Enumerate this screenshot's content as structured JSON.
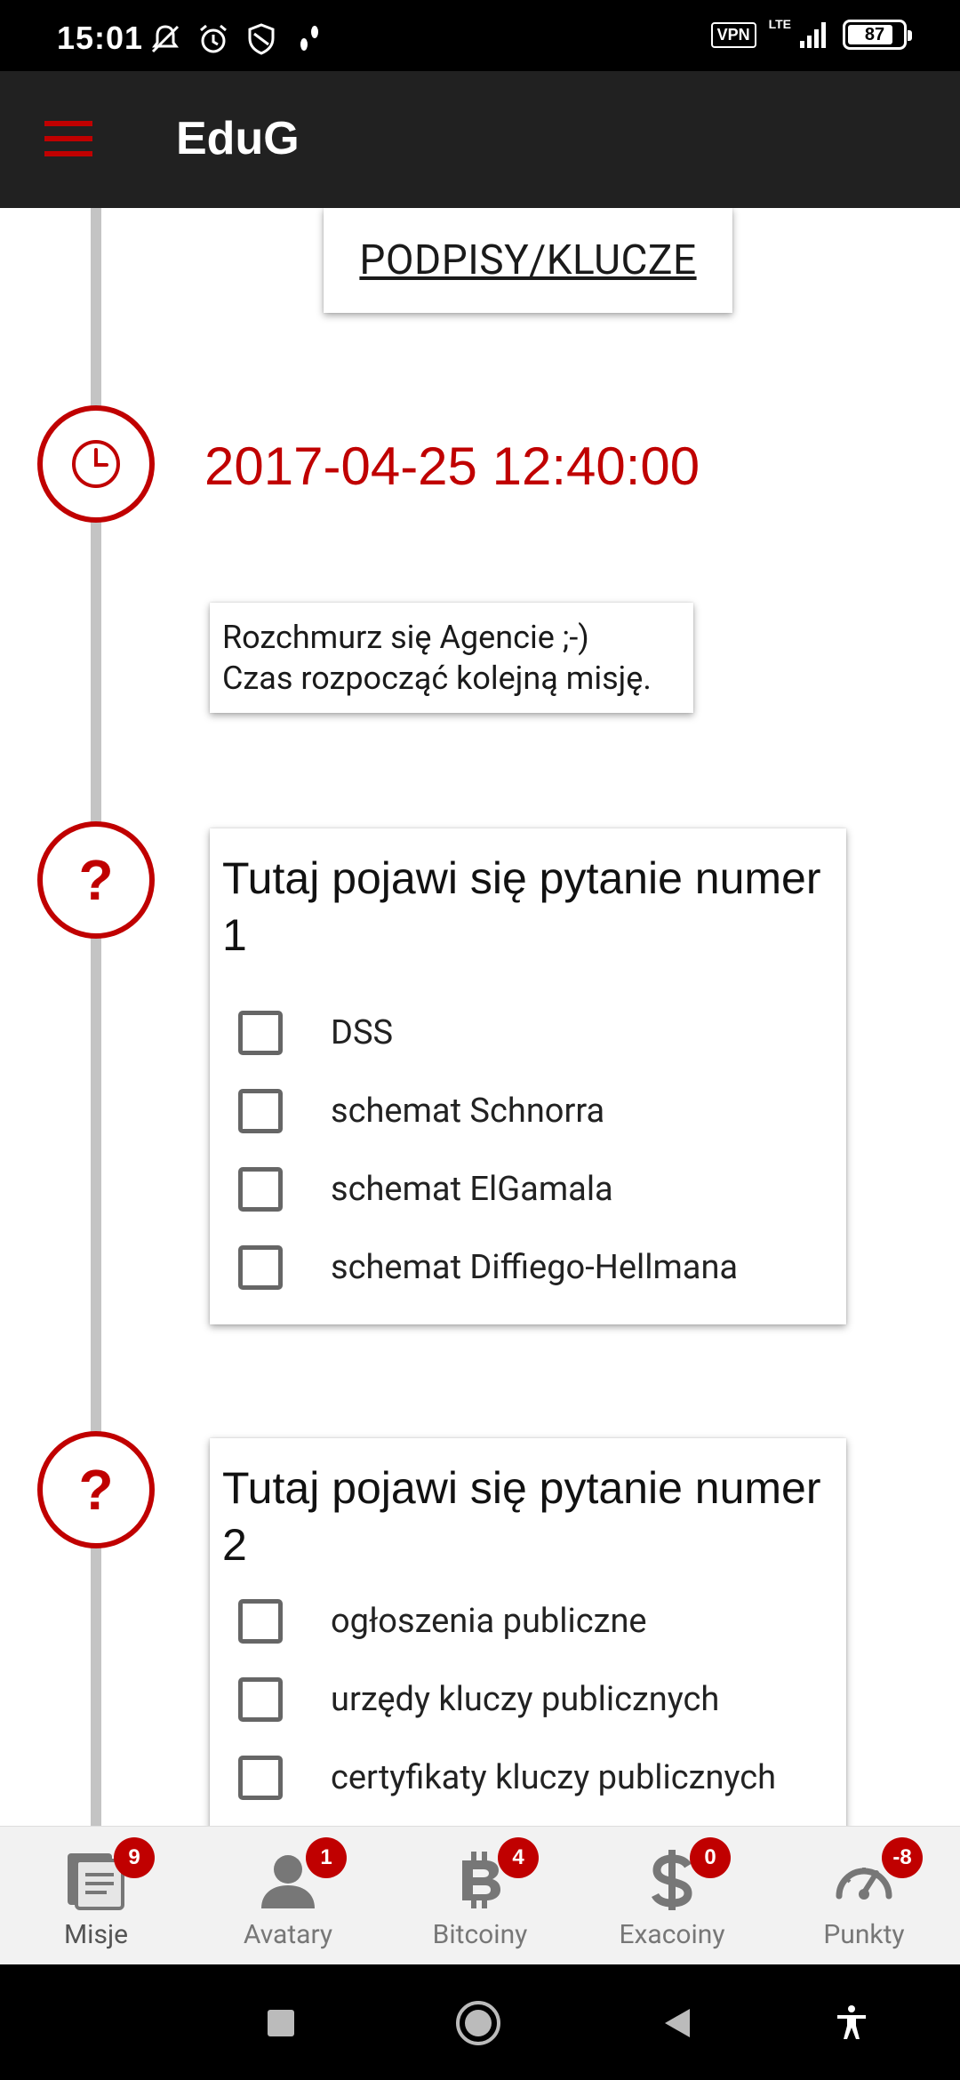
{
  "status_bar": {
    "time": "15:01",
    "vpn": "VPN",
    "network": "LTE",
    "battery": "87"
  },
  "app_bar": {
    "title": "EduG"
  },
  "content": {
    "top_button": "PODPISY/KLUCZE",
    "datetime": "2017-04-25 12:40:00",
    "message_lines": [
      "Rozchmurz się Agencie ;-)",
      "Czas rozpocząć kolejną misję."
    ],
    "questions": [
      {
        "title": "Tutaj pojawi się pytanie numer 1",
        "options": [
          "DSS",
          "schemat Schnorra",
          "schemat ElGamala",
          "schemat Diffiego-Hellmana"
        ]
      },
      {
        "title": "Tutaj pojawi się pytanie numer 2",
        "options": [
          "ogłoszenia publiczne",
          "urzędy kluczy publicznych",
          "certyfikaty kluczy publicznych"
        ]
      }
    ]
  },
  "bottom_nav": {
    "items": [
      {
        "label": "Misje",
        "badge": "9",
        "icon": "missions-icon"
      },
      {
        "label": "Avatary",
        "badge": "1",
        "icon": "avatar-icon"
      },
      {
        "label": "Bitcoiny",
        "badge": "4",
        "icon": "bitcoin-icon"
      },
      {
        "label": "Exacoiny",
        "badge": "0",
        "icon": "dollar-icon"
      },
      {
        "label": "Punkty",
        "badge": "-8",
        "icon": "speedometer-icon"
      }
    ]
  },
  "colors": {
    "accent": "#c00000",
    "app_bar": "#212121",
    "timeline": "#c4c4c4"
  }
}
